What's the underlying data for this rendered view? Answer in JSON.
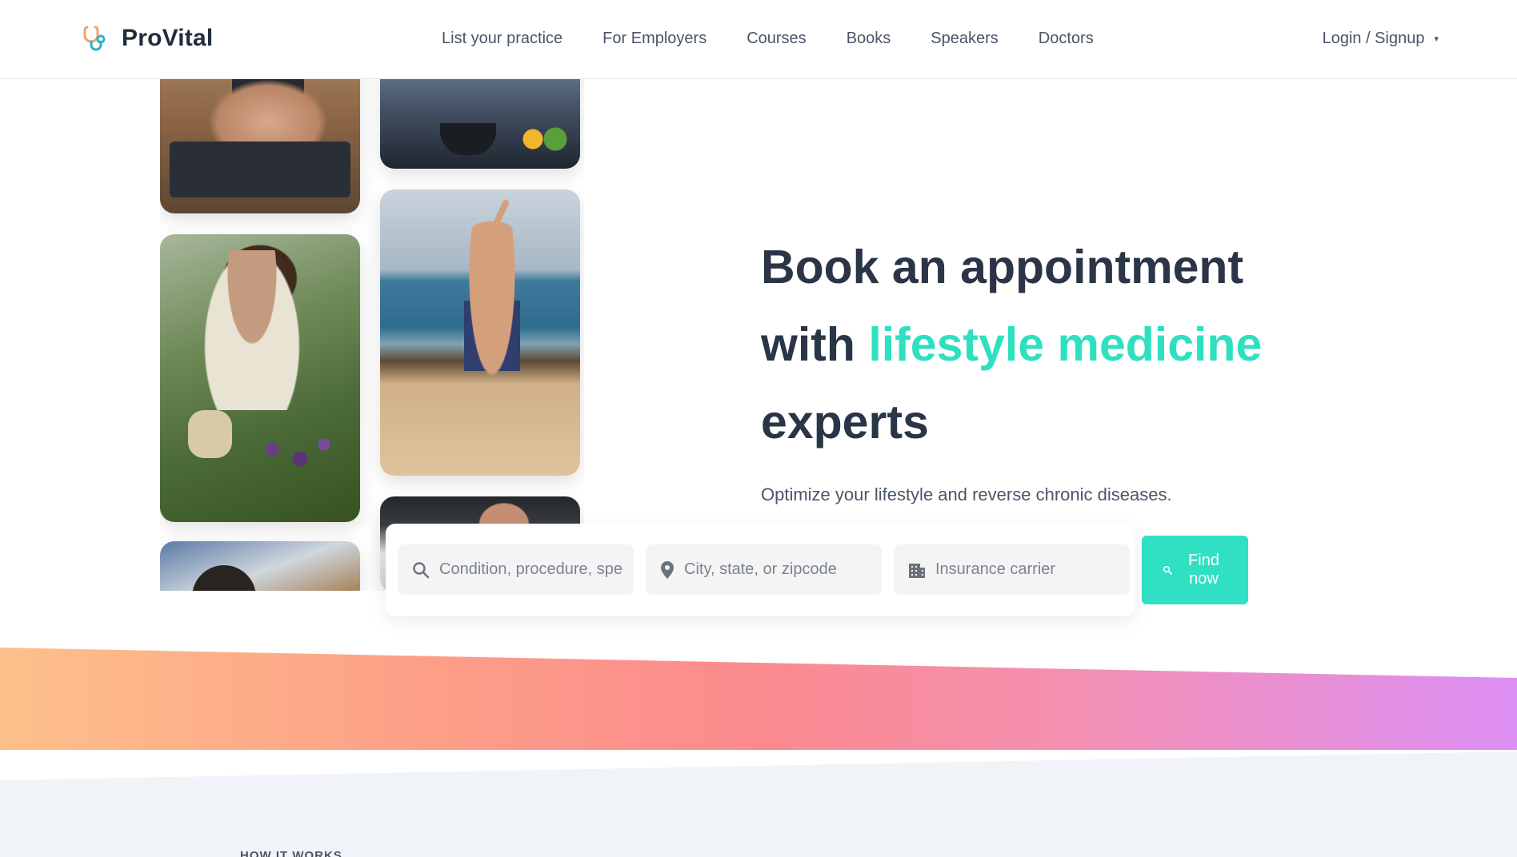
{
  "brand": {
    "name": "ProVital",
    "icon": "stethoscope-icon"
  },
  "nav": {
    "links": [
      "List your practice",
      "For Employers",
      "Courses",
      "Books",
      "Speakers",
      "Doctors"
    ],
    "login_label": "Login / Signup",
    "login_caret": "▾"
  },
  "hero": {
    "title_part1": "Book an appointment",
    "title_with": "with ",
    "title_accent": "lifestyle medicine",
    "title_part3": "experts",
    "subtitle": "Optimize your lifestyle and reverse chronic diseases."
  },
  "search": {
    "condition_placeholder": "Condition, procedure, speciality",
    "location_placeholder": "City, state, or zipcode",
    "insurance_placeholder": "Insurance carrier",
    "button_label_line1": "Find",
    "button_label_line2": "now"
  },
  "section": {
    "how_label": "HOW IT WORKS"
  },
  "colors": {
    "accent": "#2ee0c0",
    "button": "#2fe0c3",
    "heading": "#2a3547"
  }
}
